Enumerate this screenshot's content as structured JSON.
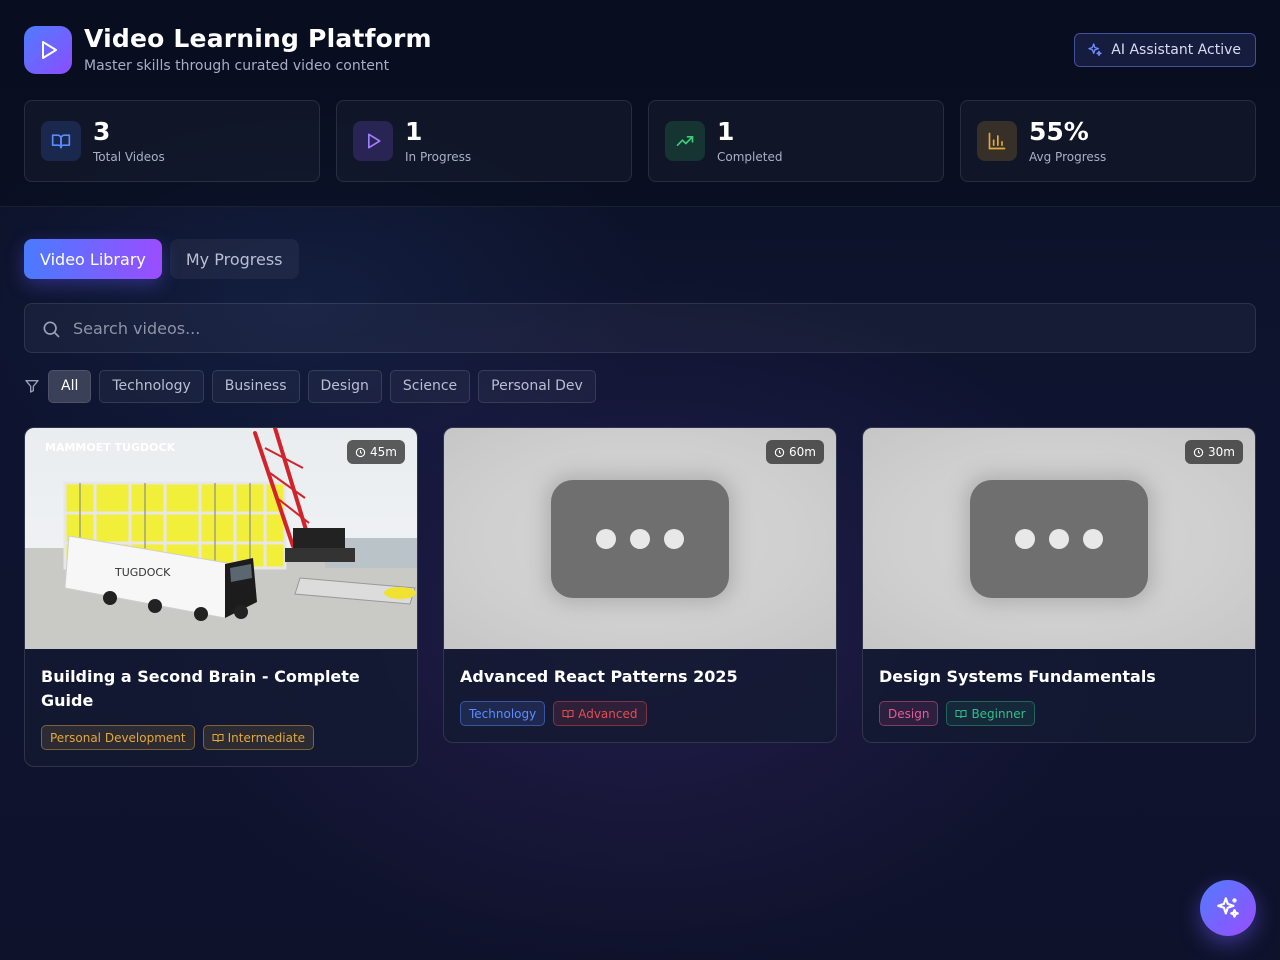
{
  "header": {
    "title": "Video Learning Platform",
    "subtitle": "Master skills through curated video content",
    "ai_badge": "AI Assistant Active",
    "logo_icon": "play-icon"
  },
  "stats": [
    {
      "value": "3",
      "label": "Total Videos",
      "icon": "book-open-icon",
      "color": "#4f7cff"
    },
    {
      "value": "1",
      "label": "In Progress",
      "icon": "play-icon",
      "color": "#9a6dff"
    },
    {
      "value": "1",
      "label": "Completed",
      "icon": "trending-up-icon",
      "color": "#2fbf6a"
    },
    {
      "value": "55%",
      "label": "Avg Progress",
      "icon": "bar-chart-icon",
      "color": "#e3a93a"
    }
  ],
  "tabs": [
    {
      "label": "Video Library",
      "active": true
    },
    {
      "label": "My Progress",
      "active": false
    }
  ],
  "search": {
    "placeholder": "Search videos...",
    "value": ""
  },
  "filters": [
    "All",
    "Technology",
    "Business",
    "Design",
    "Science",
    "Personal Dev"
  ],
  "active_filter": "All",
  "videos": [
    {
      "title": "Building a Second Brain - Complete Guide",
      "duration": "45m",
      "category": "Personal Development",
      "level": "Intermediate",
      "thumbnail_text": "MAMMOET  TUGDOCK",
      "trailer_text": "TUGDOCK"
    },
    {
      "title": "Advanced React Patterns 2025",
      "duration": "60m",
      "category": "Technology",
      "level": "Advanced"
    },
    {
      "title": "Design Systems Fundamentals",
      "duration": "30m",
      "category": "Design",
      "level": "Beginner"
    }
  ],
  "fab_icon": "sparkles-icon"
}
